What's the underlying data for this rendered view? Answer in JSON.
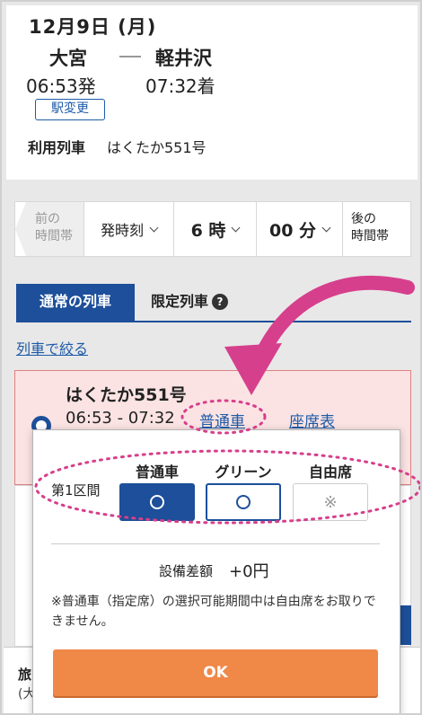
{
  "trip": {
    "date": "12月9日 (月)",
    "from_station": "大宮",
    "to_station": "軽井沢",
    "dep_time": "06:53発",
    "arr_time": "07:32着",
    "station_change_label": "駅変更",
    "train_label": "利用列車",
    "train_value": "はくたか551号"
  },
  "time_selector": {
    "prev_label_1": "前の",
    "prev_label_2": "時間帯",
    "mode_label": "発時刻",
    "hour_label": "6 時",
    "minute_label": "00 分",
    "next_label_1": "後の",
    "next_label_2": "時間帯"
  },
  "tabs": {
    "normal": "通常の列車",
    "limited": "限定列車",
    "help_icon_glyph": "?"
  },
  "filter_link": "列車で絞る",
  "train_card": {
    "name": "はくたか551号",
    "time": "06:53 - 07:32",
    "seat_type_link": "普通車",
    "seat_map_link": "座席表"
  },
  "bottom": {
    "line1": "旅",
    "line2": "(大"
  },
  "popup": {
    "section_label": "第1区間",
    "columns": [
      "普通車",
      "グリーン",
      "自由席"
    ],
    "unavailable_mark": "※",
    "diff_label": "設備差額",
    "diff_value": "+0円",
    "note": "※普通車（指定席）の選択可能期間中は自由席をお取りできません。",
    "ok_label": "OK"
  },
  "colors": {
    "accent_blue": "#1d4f9a",
    "ok_orange": "#f08848",
    "highlight_pink": "#d63f8c"
  }
}
